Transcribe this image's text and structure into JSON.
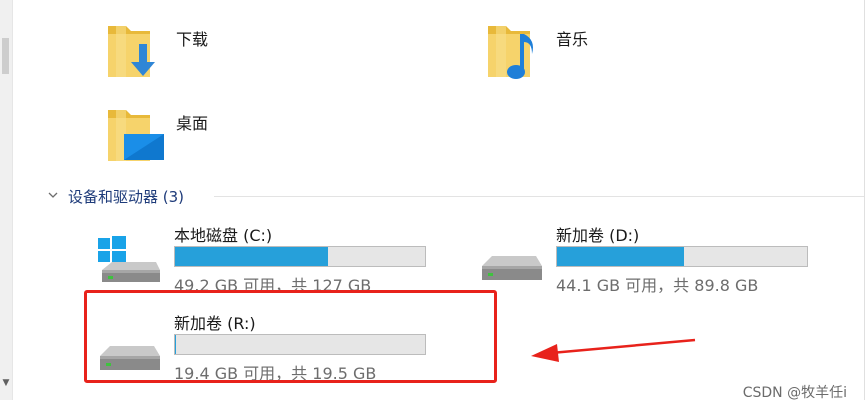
{
  "folders": [
    {
      "label": "下载",
      "icon": "downloads-folder-icon"
    },
    {
      "label": "音乐",
      "icon": "music-folder-icon"
    },
    {
      "label": "桌面",
      "icon": "desktop-folder-icon"
    }
  ],
  "section": {
    "title": "设备和驱动器 (3)"
  },
  "drives": [
    {
      "name": "本地磁盘 (C:)",
      "free_text": "49.2 GB 可用，共 127 GB",
      "used_fraction": 0.613,
      "icon": "windows-drive-icon"
    },
    {
      "name": "新加卷 (D:)",
      "free_text": "44.1 GB 可用，共 89.8 GB",
      "used_fraction": 0.509,
      "icon": "hard-drive-icon"
    },
    {
      "name": "新加卷 (R:)",
      "free_text": "19.4 GB 可用，共 19.5 GB",
      "used_fraction": 0.005,
      "icon": "hard-drive-icon"
    }
  ],
  "colors": {
    "bar_fill": "#26a0da",
    "bar_bg": "#e6e6e6",
    "annotation": "#e8221b"
  },
  "watermark": "CSDN @牧羊任i"
}
